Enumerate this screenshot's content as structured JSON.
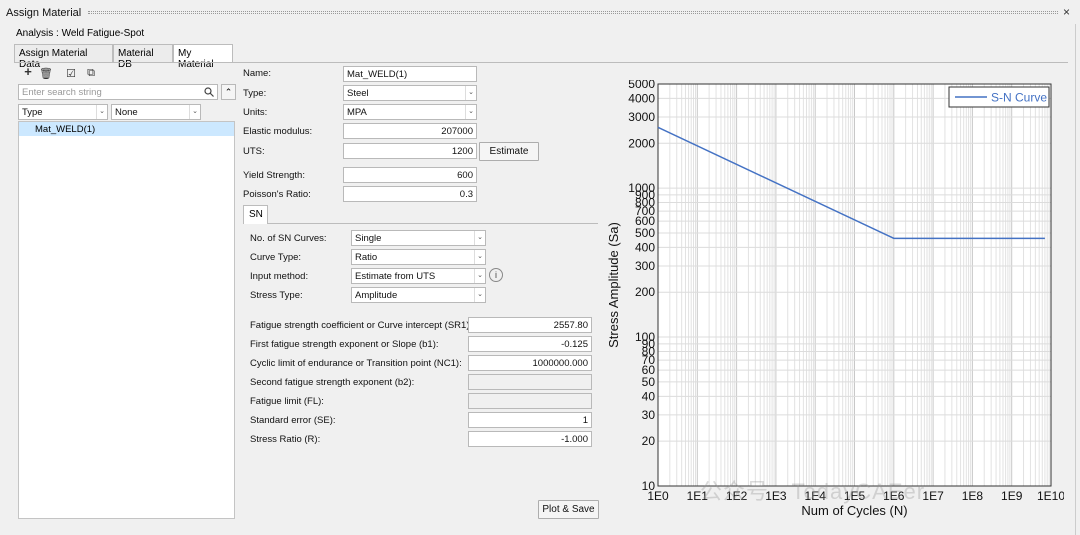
{
  "window": {
    "title": "Assign Material",
    "close": "×"
  },
  "analysis_label": "Analysis : Weld Fatigue-Spot",
  "tabs": [
    "Assign Material Data",
    "Material DB",
    "My Material"
  ],
  "toolbar": {
    "add": "+",
    "delete": "🗑",
    "check": "☑",
    "export": "⧉",
    "collapse": "⌃"
  },
  "search": {
    "placeholder": "Enter search string",
    "icon": "search-icon"
  },
  "filters": {
    "type": "Type",
    "value": "None"
  },
  "materials": [
    "Mat_WELD(1)"
  ],
  "form": {
    "name_label": "Name:",
    "name": "Mat_WELD(1)",
    "type_label": "Type:",
    "type": "Steel",
    "units_label": "Units:",
    "units": "MPA",
    "elastic_label": "Elastic modulus:",
    "elastic": "207000",
    "uts_label": "UTS:",
    "uts": "1200",
    "estimate_button": "Estimate",
    "yield_label": "Yield Strength:",
    "yield": "600",
    "poisson_label": "Poisson's Ratio:",
    "poisson": "0.3"
  },
  "sn_tab": "SN",
  "sn": {
    "curves_label": "No. of SN Curves:",
    "curves": "Single",
    "curve_type_label": "Curve Type:",
    "curve_type": "Ratio",
    "input_method_label": "Input method:",
    "input_method": "Estimate from UTS",
    "stress_type_label": "Stress Type:",
    "stress_type": "Amplitude",
    "sr1_label": "Fatigue strength coefficient or Curve intercept (SR1):",
    "sr1": "2557.80",
    "b1_label": "First fatigue strength exponent or Slope (b1):",
    "b1": "-0.125",
    "nc1_label": "Cyclic limit of endurance or Transition point (NC1):",
    "nc1": "1000000.000",
    "b2_label": "Second fatigue strength exponent (b2):",
    "b2": "",
    "fl_label": "Fatigue limit (FL):",
    "fl": "",
    "se_label": "Standard error (SE):",
    "se": "1",
    "r_label": "Stress Ratio (R):",
    "r": "-1.000"
  },
  "plot_button": "Plot & Save",
  "watermark": "公众号 · TodayCAEer",
  "chart_data": {
    "type": "line",
    "xlabel": "Num of Cycles (N)",
    "ylabel": "Stress Amplitude (Sa)",
    "xscale": "log",
    "yscale": "log",
    "xlim": [
      1,
      10000000000
    ],
    "ylim": [
      10,
      5000
    ],
    "xticks": [
      "1E0",
      "1E1",
      "1E2",
      "1E3",
      "1E4",
      "1E5",
      "1E6",
      "1E7",
      "1E8",
      "1E9",
      "1E10"
    ],
    "yticks": [
      10,
      20,
      30,
      40,
      50,
      60,
      70,
      80,
      90,
      100,
      200,
      300,
      400,
      500,
      600,
      700,
      800,
      900,
      1000,
      2000,
      3000,
      4000,
      5000
    ],
    "grid": true,
    "legend": "top-right",
    "series": [
      {
        "name": "S-N Curve",
        "color": "#4472c4",
        "points": [
          [
            1,
            2557.8
          ],
          [
            1000000,
            460.0
          ],
          [
            7000000000,
            460.0
          ]
        ]
      }
    ]
  }
}
